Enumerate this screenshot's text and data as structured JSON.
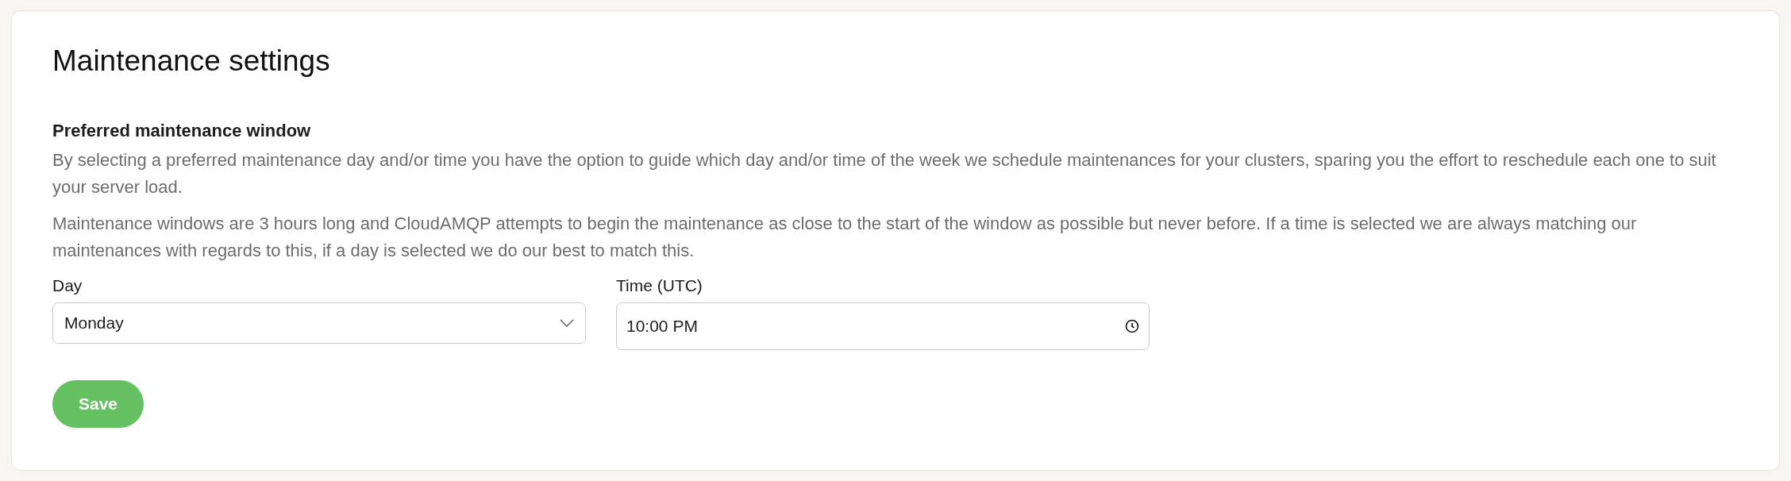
{
  "card": {
    "title": "Maintenance settings",
    "section_title": "Preferred maintenance window",
    "paragraphs": [
      "By selecting a preferred maintenance day and/or time you have the option to guide which day and/or time of the week we schedule maintenances for your clusters, sparing you the effort to reschedule each one to suit your server load.",
      "Maintenance windows are 3 hours long and CloudAMQP attempts to begin the maintenance as close to the start of the window as possible but never before. If a time is selected we are always matching our maintenances with regards to this, if a day is selected we do our best to match this."
    ],
    "fields": [
      {
        "kind": "select",
        "label": "Day",
        "value": "Monday"
      },
      {
        "kind": "time",
        "label": "Time (UTC)",
        "value": "10:00 PM"
      }
    ],
    "save_button": "Save"
  }
}
